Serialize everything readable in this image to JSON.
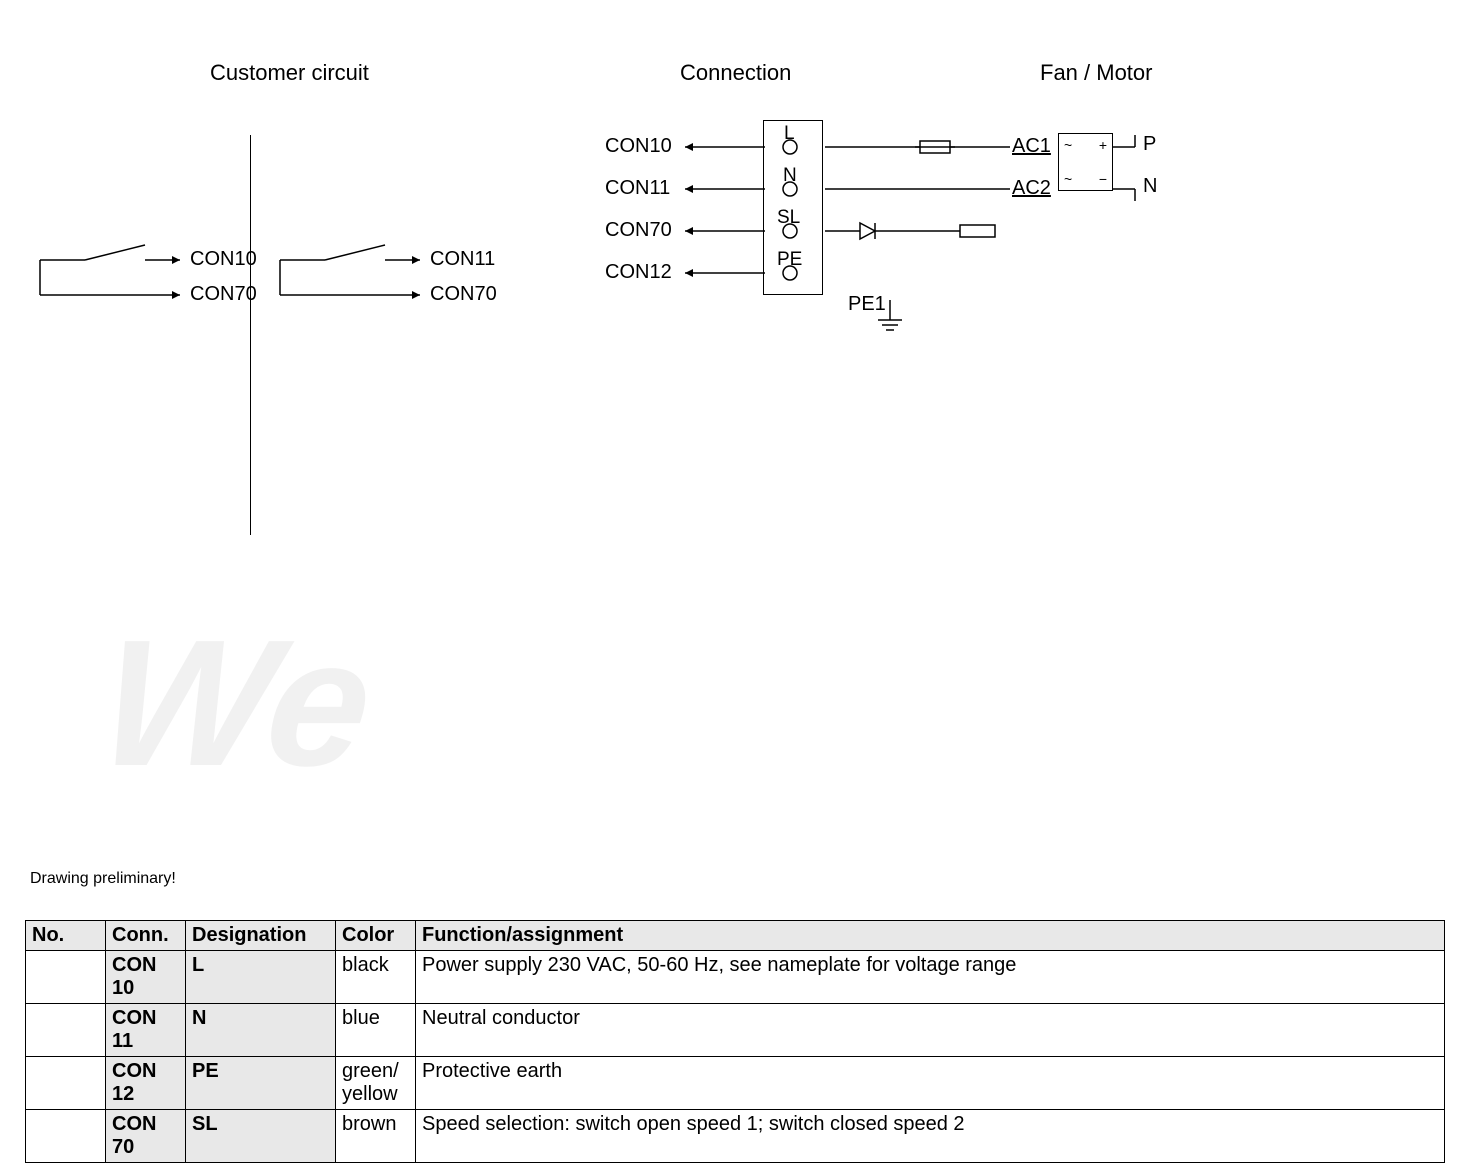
{
  "headers": {
    "customer": "Customer circuit",
    "connection": "Connection",
    "fanmotor": "Fan / Motor"
  },
  "switch_labels": {
    "s1_a": "CON10",
    "s1_b": "CON70",
    "s2_a": "CON11",
    "s2_b": "CON70"
  },
  "conn": {
    "r1": "CON10",
    "r2": "CON11",
    "r3": "CON70",
    "r4": "CON12",
    "t1": "L",
    "t2": "N",
    "t3": "SL",
    "t4": "PE"
  },
  "motor": {
    "ac1": "AC1",
    "ac2": "AC2",
    "p": "P",
    "n": "N",
    "pe1": "PE1"
  },
  "preliminary": "Drawing preliminary!",
  "table": {
    "headers": {
      "no": "No.",
      "conn": "Conn.",
      "designation": "Designation",
      "color": "Color",
      "function": "Function/assignment"
    },
    "rows": [
      {
        "no": "",
        "conn": "CON 10",
        "desig": "L",
        "color": "black",
        "func": "Power supply 230 VAC, 50-60 Hz, see nameplate for voltage range"
      },
      {
        "no": "",
        "conn": "CON 11",
        "desig": "N",
        "color": "blue",
        "func": "Neutral conductor"
      },
      {
        "no": "",
        "conn": "CON 12",
        "desig": "PE",
        "color": "green/ yellow",
        "func": "Protective earth"
      },
      {
        "no": "",
        "conn": "CON 70",
        "desig": "SL",
        "color": "brown",
        "func": "Speed selection: switch open speed 1; switch closed speed 2"
      }
    ]
  }
}
